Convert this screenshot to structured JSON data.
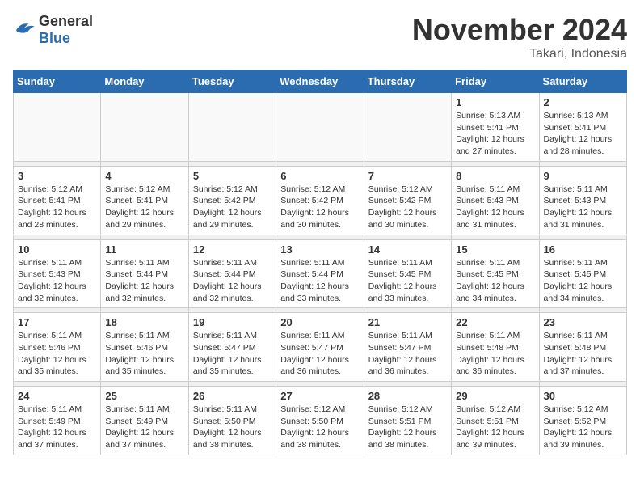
{
  "logo": {
    "general": "General",
    "blue": "Blue"
  },
  "title": "November 2024",
  "location": "Takari, Indonesia",
  "days_of_week": [
    "Sunday",
    "Monday",
    "Tuesday",
    "Wednesday",
    "Thursday",
    "Friday",
    "Saturday"
  ],
  "weeks": [
    [
      {
        "day": "",
        "info": ""
      },
      {
        "day": "",
        "info": ""
      },
      {
        "day": "",
        "info": ""
      },
      {
        "day": "",
        "info": ""
      },
      {
        "day": "",
        "info": ""
      },
      {
        "day": "1",
        "info": "Sunrise: 5:13 AM\nSunset: 5:41 PM\nDaylight: 12 hours\nand 27 minutes."
      },
      {
        "day": "2",
        "info": "Sunrise: 5:13 AM\nSunset: 5:41 PM\nDaylight: 12 hours\nand 28 minutes."
      }
    ],
    [
      {
        "day": "3",
        "info": "Sunrise: 5:12 AM\nSunset: 5:41 PM\nDaylight: 12 hours\nand 28 minutes."
      },
      {
        "day": "4",
        "info": "Sunrise: 5:12 AM\nSunset: 5:41 PM\nDaylight: 12 hours\nand 29 minutes."
      },
      {
        "day": "5",
        "info": "Sunrise: 5:12 AM\nSunset: 5:42 PM\nDaylight: 12 hours\nand 29 minutes."
      },
      {
        "day": "6",
        "info": "Sunrise: 5:12 AM\nSunset: 5:42 PM\nDaylight: 12 hours\nand 30 minutes."
      },
      {
        "day": "7",
        "info": "Sunrise: 5:12 AM\nSunset: 5:42 PM\nDaylight: 12 hours\nand 30 minutes."
      },
      {
        "day": "8",
        "info": "Sunrise: 5:11 AM\nSunset: 5:43 PM\nDaylight: 12 hours\nand 31 minutes."
      },
      {
        "day": "9",
        "info": "Sunrise: 5:11 AM\nSunset: 5:43 PM\nDaylight: 12 hours\nand 31 minutes."
      }
    ],
    [
      {
        "day": "10",
        "info": "Sunrise: 5:11 AM\nSunset: 5:43 PM\nDaylight: 12 hours\nand 32 minutes."
      },
      {
        "day": "11",
        "info": "Sunrise: 5:11 AM\nSunset: 5:44 PM\nDaylight: 12 hours\nand 32 minutes."
      },
      {
        "day": "12",
        "info": "Sunrise: 5:11 AM\nSunset: 5:44 PM\nDaylight: 12 hours\nand 32 minutes."
      },
      {
        "day": "13",
        "info": "Sunrise: 5:11 AM\nSunset: 5:44 PM\nDaylight: 12 hours\nand 33 minutes."
      },
      {
        "day": "14",
        "info": "Sunrise: 5:11 AM\nSunset: 5:45 PM\nDaylight: 12 hours\nand 33 minutes."
      },
      {
        "day": "15",
        "info": "Sunrise: 5:11 AM\nSunset: 5:45 PM\nDaylight: 12 hours\nand 34 minutes."
      },
      {
        "day": "16",
        "info": "Sunrise: 5:11 AM\nSunset: 5:45 PM\nDaylight: 12 hours\nand 34 minutes."
      }
    ],
    [
      {
        "day": "17",
        "info": "Sunrise: 5:11 AM\nSunset: 5:46 PM\nDaylight: 12 hours\nand 35 minutes."
      },
      {
        "day": "18",
        "info": "Sunrise: 5:11 AM\nSunset: 5:46 PM\nDaylight: 12 hours\nand 35 minutes."
      },
      {
        "day": "19",
        "info": "Sunrise: 5:11 AM\nSunset: 5:47 PM\nDaylight: 12 hours\nand 35 minutes."
      },
      {
        "day": "20",
        "info": "Sunrise: 5:11 AM\nSunset: 5:47 PM\nDaylight: 12 hours\nand 36 minutes."
      },
      {
        "day": "21",
        "info": "Sunrise: 5:11 AM\nSunset: 5:47 PM\nDaylight: 12 hours\nand 36 minutes."
      },
      {
        "day": "22",
        "info": "Sunrise: 5:11 AM\nSunset: 5:48 PM\nDaylight: 12 hours\nand 36 minutes."
      },
      {
        "day": "23",
        "info": "Sunrise: 5:11 AM\nSunset: 5:48 PM\nDaylight: 12 hours\nand 37 minutes."
      }
    ],
    [
      {
        "day": "24",
        "info": "Sunrise: 5:11 AM\nSunset: 5:49 PM\nDaylight: 12 hours\nand 37 minutes."
      },
      {
        "day": "25",
        "info": "Sunrise: 5:11 AM\nSunset: 5:49 PM\nDaylight: 12 hours\nand 37 minutes."
      },
      {
        "day": "26",
        "info": "Sunrise: 5:11 AM\nSunset: 5:50 PM\nDaylight: 12 hours\nand 38 minutes."
      },
      {
        "day": "27",
        "info": "Sunrise: 5:12 AM\nSunset: 5:50 PM\nDaylight: 12 hours\nand 38 minutes."
      },
      {
        "day": "28",
        "info": "Sunrise: 5:12 AM\nSunset: 5:51 PM\nDaylight: 12 hours\nand 38 minutes."
      },
      {
        "day": "29",
        "info": "Sunrise: 5:12 AM\nSunset: 5:51 PM\nDaylight: 12 hours\nand 39 minutes."
      },
      {
        "day": "30",
        "info": "Sunrise: 5:12 AM\nSunset: 5:52 PM\nDaylight: 12 hours\nand 39 minutes."
      }
    ]
  ]
}
